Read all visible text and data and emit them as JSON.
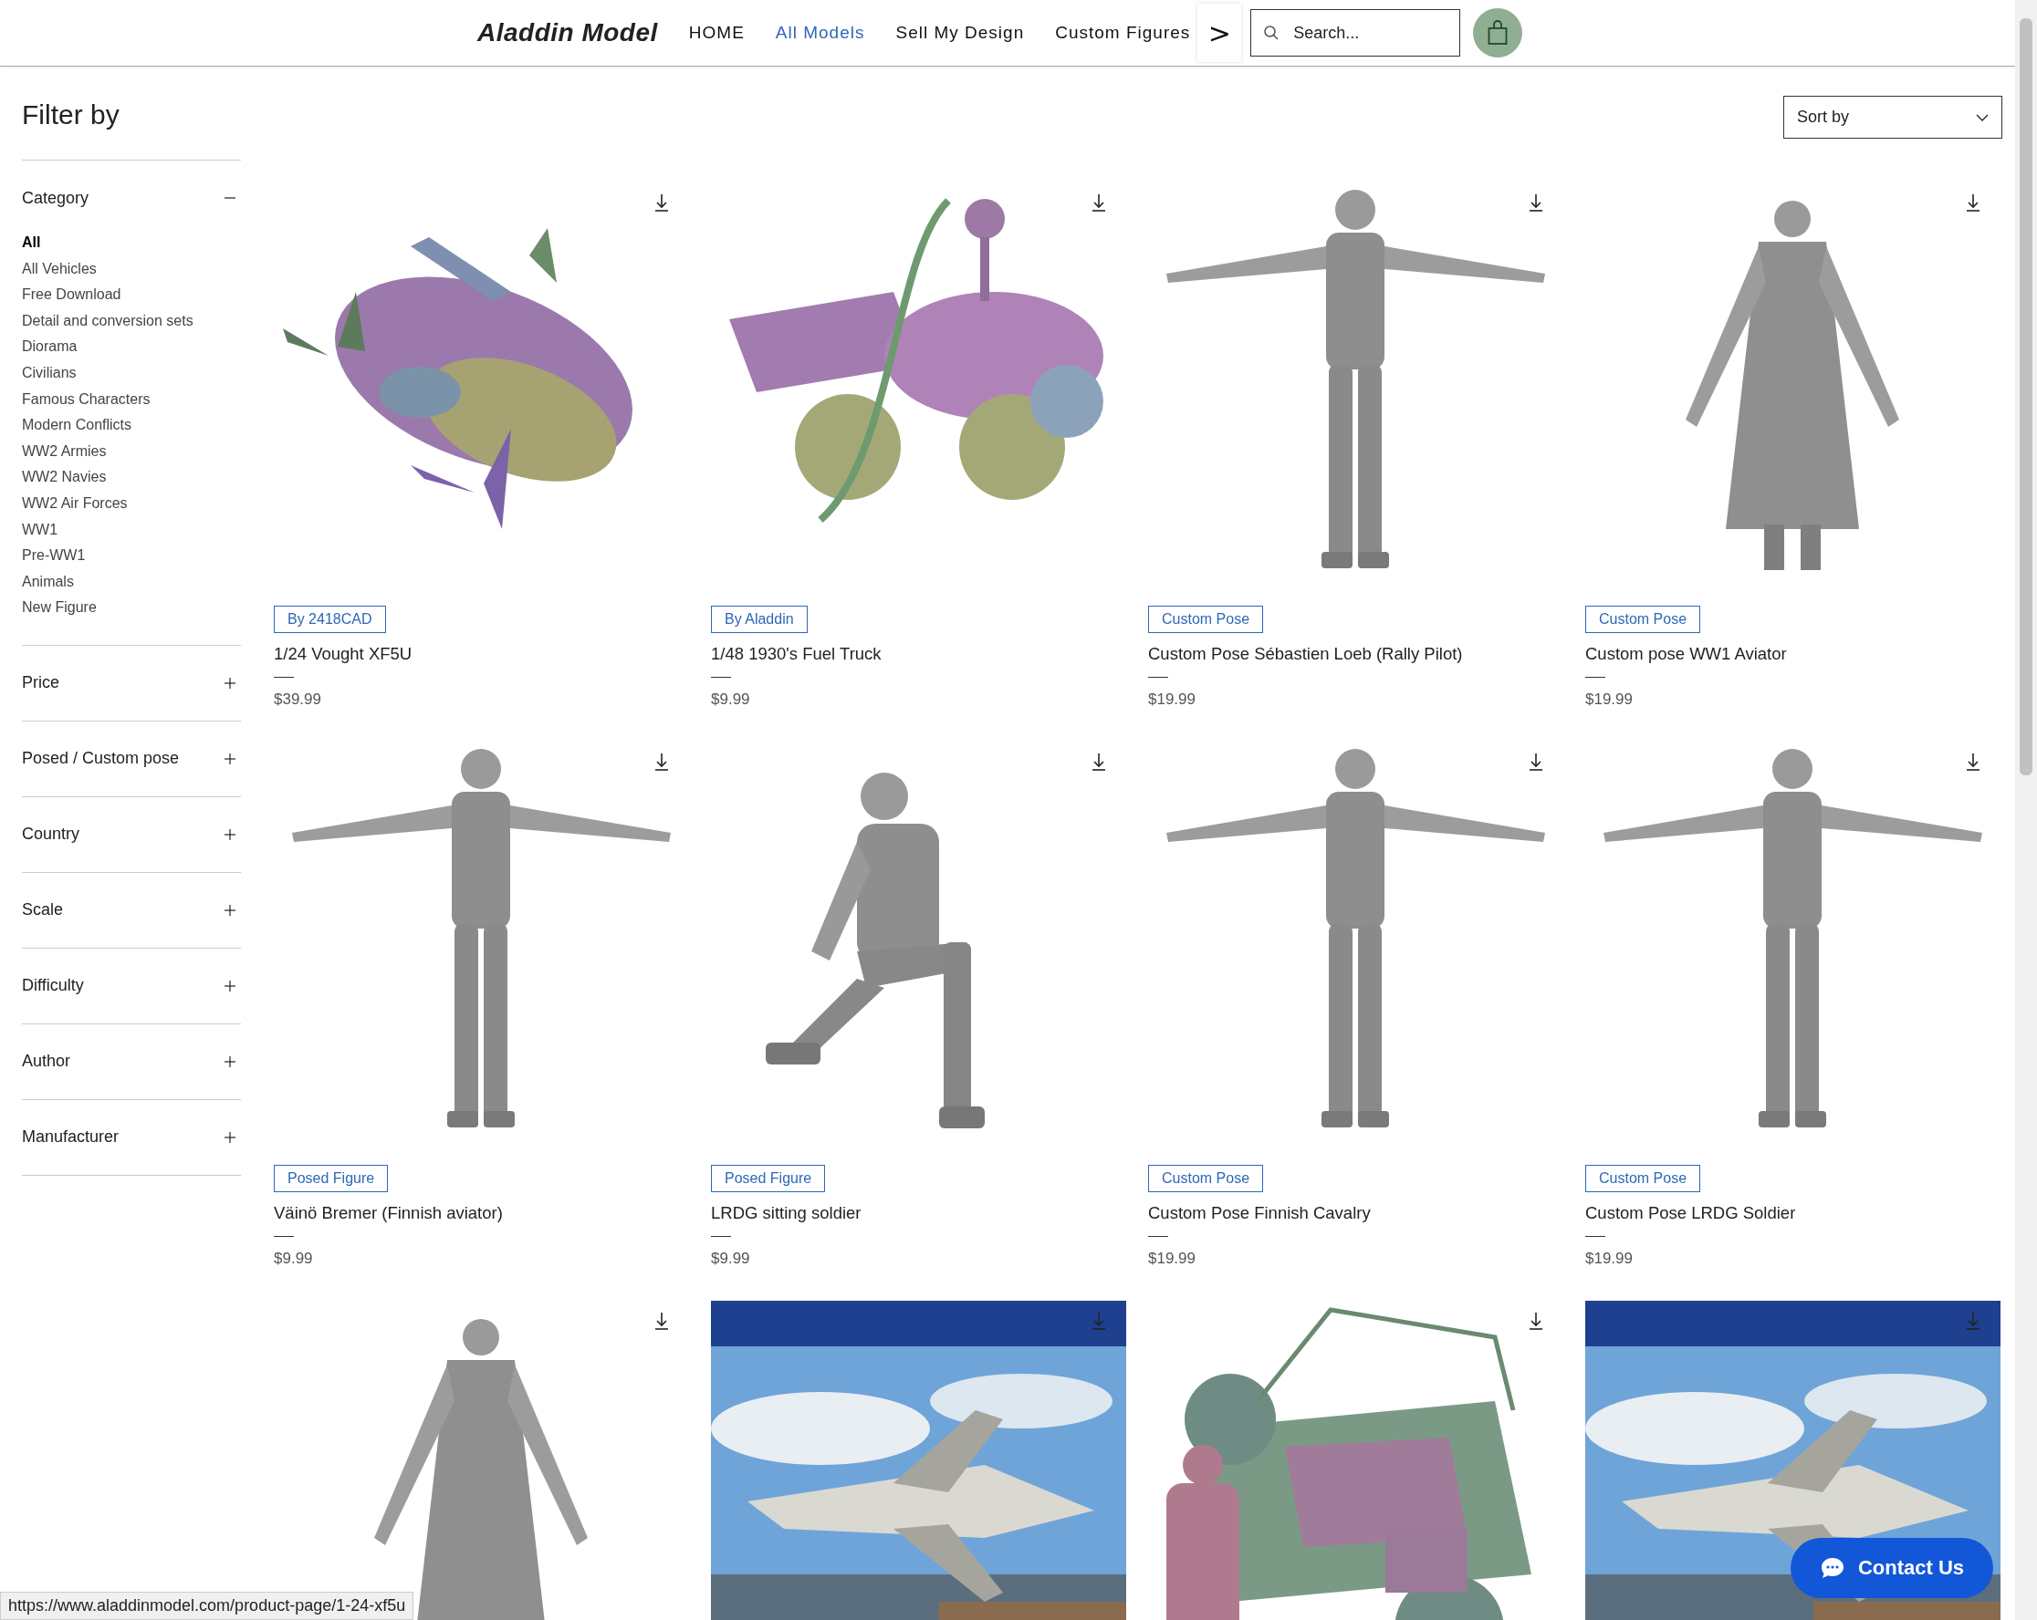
{
  "header": {
    "logo": "Aladdin Model",
    "nav": [
      {
        "label": "HOME",
        "selected": false
      },
      {
        "label": "All Models",
        "selected": true
      },
      {
        "label": "Sell My Design",
        "selected": false
      },
      {
        "label": "Custom Figures",
        "selected": false
      }
    ],
    "more": ">",
    "search": {
      "placeholder": "Search..."
    }
  },
  "sidebar": {
    "title": "Filter by",
    "filters": [
      {
        "label": "Category",
        "expanded": true,
        "items": [
          {
            "label": "All",
            "selected": true
          },
          {
            "label": "All Vehicles",
            "selected": false
          },
          {
            "label": "Free Download",
            "selected": false
          },
          {
            "label": "Detail and conversion sets",
            "selected": false
          },
          {
            "label": "Diorama",
            "selected": false
          },
          {
            "label": "Civilians",
            "selected": false
          },
          {
            "label": "Famous Characters",
            "selected": false
          },
          {
            "label": "Modern Conflicts",
            "selected": false
          },
          {
            "label": "WW2 Armies",
            "selected": false
          },
          {
            "label": "WW2 Navies",
            "selected": false
          },
          {
            "label": "WW2 Air Forces",
            "selected": false
          },
          {
            "label": "WW1",
            "selected": false
          },
          {
            "label": "Pre-WW1",
            "selected": false
          },
          {
            "label": "Animals",
            "selected": false
          },
          {
            "label": "New Figure",
            "selected": false
          }
        ]
      },
      {
        "label": "Price",
        "expanded": false
      },
      {
        "label": "Posed / Custom pose",
        "expanded": false
      },
      {
        "label": "Country",
        "expanded": false
      },
      {
        "label": "Scale",
        "expanded": false
      },
      {
        "label": "Difficulty",
        "expanded": false
      },
      {
        "label": "Author",
        "expanded": false
      },
      {
        "label": "Manufacturer",
        "expanded": false
      }
    ]
  },
  "sort": {
    "label": "Sort by"
  },
  "products": [
    {
      "tag": "By 2418CAD",
      "name": "1/24 Vought XF5U",
      "price": "$39.99"
    },
    {
      "tag": "By Aladdin",
      "name": "1/48 1930's Fuel Truck",
      "price": "$9.99"
    },
    {
      "tag": "Custom Pose",
      "name": "Custom Pose Sébastien Loeb (Rally Pilot)",
      "price": "$19.99"
    },
    {
      "tag": "Custom Pose",
      "name": "Custom pose WW1 Aviator",
      "price": "$19.99"
    },
    {
      "tag": "Posed Figure",
      "name": "Väinö Bremer (Finnish aviator)",
      "price": "$9.99"
    },
    {
      "tag": "Posed Figure",
      "name": "LRDG sitting soldier",
      "price": "$9.99"
    },
    {
      "tag": "Custom Pose",
      "name": "Custom Pose Finnish Cavalry",
      "price": "$19.99"
    },
    {
      "tag": "Custom Pose",
      "name": "Custom Pose LRDG Soldier",
      "price": "$19.99"
    },
    {
      "kind": "picture"
    },
    {
      "kind": "picture"
    },
    {
      "kind": "picture"
    },
    {
      "kind": "picture"
    }
  ],
  "status_url": "https://www.aladdinmodel.com/product-page/1-24-xf5u",
  "chat_button": "Contact Us"
}
